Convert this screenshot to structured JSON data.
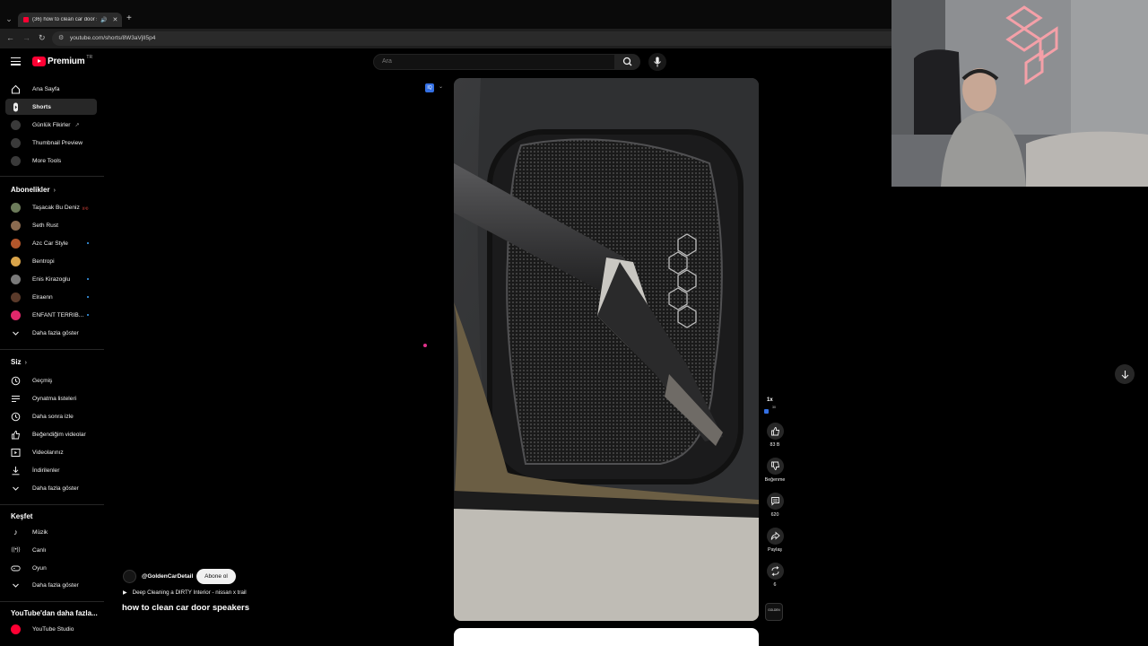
{
  "browser": {
    "tab_title": "(36) how to clean car door s",
    "address": "youtube.com/shorts/8W3aVjlI5p4",
    "new_tab_label": "+"
  },
  "masthead": {
    "logo_text": "Premium",
    "country_code": "TR",
    "search_placeholder": "Ara"
  },
  "sidebar": {
    "main": [
      {
        "label": "Ana Sayfa",
        "icon": "home-icon"
      },
      {
        "label": "Shorts",
        "icon": "shorts-icon",
        "active": true
      },
      {
        "label": "Günlük Fikirler",
        "icon": "channel-icon",
        "external": true
      },
      {
        "label": "Thumbnail Preview",
        "icon": "channel-icon"
      },
      {
        "label": "More Tools",
        "icon": "channel-icon"
      }
    ],
    "subscriptions_title": "Abonelikler",
    "subscriptions": [
      {
        "label": "Taşacak Bu Deniz",
        "color": "#6c7b5a",
        "live": true
      },
      {
        "label": "Seth Rust",
        "color": "#8a6a4f"
      },
      {
        "label": "Azc Car Style",
        "color": "#b3562b",
        "new": true
      },
      {
        "label": "Bentropi",
        "color": "#d9a44a"
      },
      {
        "label": "Enis Kirazoglu",
        "color": "#7a7a7a",
        "new": true
      },
      {
        "label": "Elraenn",
        "color": "#5a3a2a",
        "new": true
      },
      {
        "label": "ENFANT TERRIB...",
        "color": "#e0286b",
        "new": true
      }
    ],
    "subscriptions_more": "Daha fazla göster",
    "you_title": "Siz",
    "you": [
      {
        "label": "Geçmiş",
        "icon": "history-icon"
      },
      {
        "label": "Oynatma listeleri",
        "icon": "playlist-icon"
      },
      {
        "label": "Daha sonra izle",
        "icon": "clock-icon"
      },
      {
        "label": "Beğendiğim videolar",
        "icon": "thumbs-up-icon"
      },
      {
        "label": "Videolarınız",
        "icon": "video-icon"
      },
      {
        "label": "İndirilenler",
        "icon": "download-icon"
      }
    ],
    "you_more": "Daha fazla göster",
    "explore_title": "Keşfet",
    "explore": [
      {
        "label": "Müzik",
        "icon": "music-icon"
      },
      {
        "label": "Canlı",
        "icon": "live-icon"
      },
      {
        "label": "Oyun",
        "icon": "gamepad-icon"
      }
    ],
    "explore_more": "Daha fazla göster",
    "more_title": "YouTube'dan daha fazla...",
    "more": [
      {
        "label": "YouTube Studio",
        "color": "#ff0033"
      }
    ]
  },
  "short": {
    "channel": "@GoldenCarDetail",
    "subscribe_label": "Abone ol",
    "linked_video": "Deep Cleaning a DIRTY Interior - nissan x trail",
    "title": "how to clean car door speakers",
    "speed": "1x",
    "speed_sub": "30",
    "likes": "83 B",
    "dislike_label": "Beğenme",
    "comments": "620",
    "share_label": "Paylaş",
    "remix_count": "6",
    "channel_avatar_text": "GOLDEN"
  },
  "colors": {
    "brand_red": "#ff0033",
    "background": "#0f0f0f",
    "active_item": "#272727"
  }
}
